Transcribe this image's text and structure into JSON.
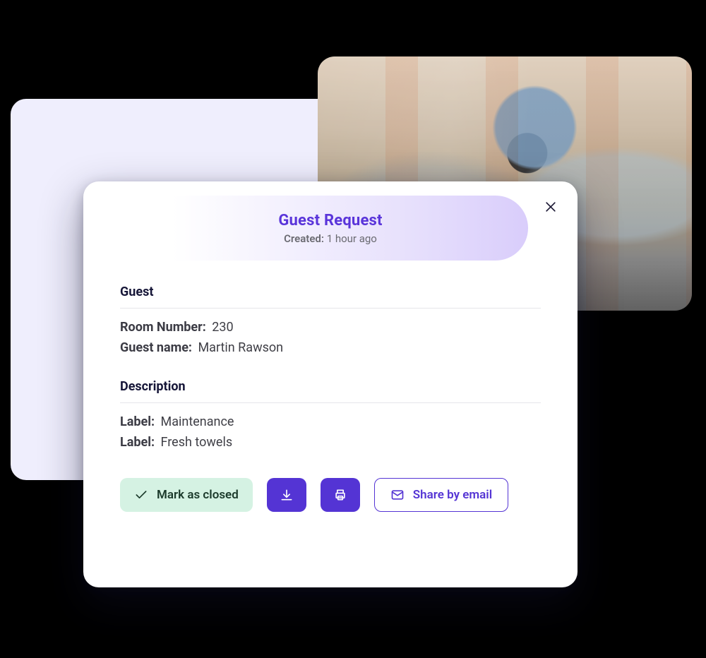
{
  "header": {
    "title": "Guest Request",
    "created_prefix": "Created:",
    "created_value": "1 hour ago"
  },
  "guest": {
    "heading": "Guest",
    "room_label": "Room Number:",
    "room_value": "230",
    "name_label": "Guest name:",
    "name_value": "Martin Rawson"
  },
  "description": {
    "heading": "Description",
    "items": [
      {
        "label": "Label:",
        "value": "Maintenance"
      },
      {
        "label": "Label:",
        "value": "Fresh towels"
      }
    ]
  },
  "actions": {
    "mark_closed": "Mark as closed",
    "share_email": "Share by email"
  }
}
